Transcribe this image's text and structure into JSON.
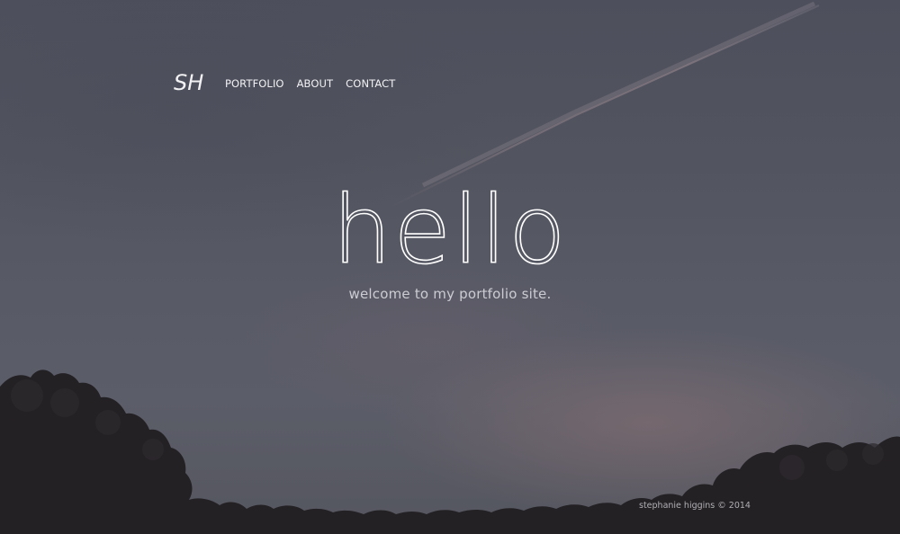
{
  "header": {
    "logo": "SH",
    "nav": [
      {
        "label": "PORTFOLIO"
      },
      {
        "label": "ABOUT"
      },
      {
        "label": "CONTACT"
      }
    ]
  },
  "hero": {
    "headline": "hello",
    "subline": "welcome to my portfolio site.",
    "background_image": "dusk-sky-with-treeline"
  },
  "footer": {
    "copyright": "stephanie higgins © 2014"
  },
  "colors": {
    "text": "#f2f2f4",
    "sky": "#555764",
    "trees": "#262326"
  }
}
